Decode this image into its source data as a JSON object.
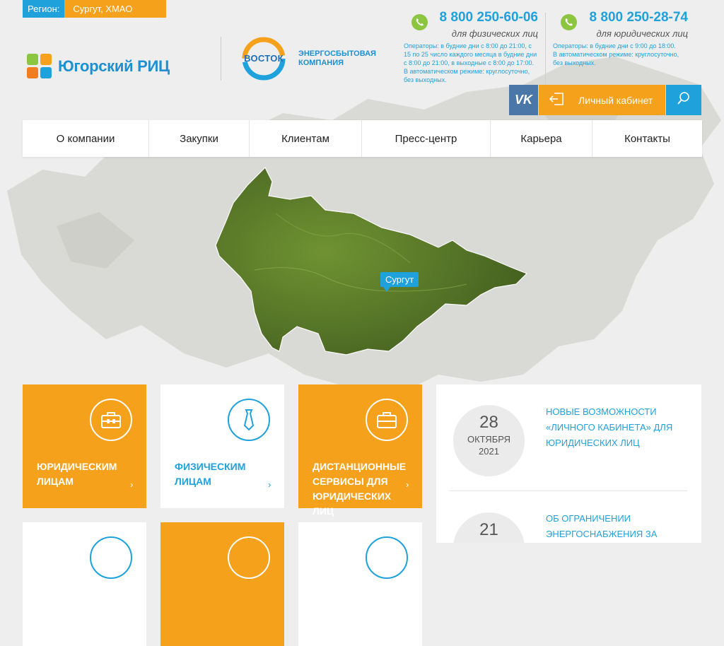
{
  "region": {
    "label": "Регион:",
    "value": "Сургут, ХМАО"
  },
  "logos": {
    "ugra": "Югорский РИЦ",
    "vostok": "ВОСТОК",
    "vostok_sub": "Энергосбытовая компания"
  },
  "phones": [
    {
      "number": "8 800 250-60-06",
      "sub": "для физических лиц",
      "note": "Операторы: в будние дни с 8:00 до 21:00, с 15 по 25 число каждого месяца в будние дни с 8:00 до 21:00, в выходные с 8:00 до 17:00. В автоматическом режиме: круглосуточно, без выходных."
    },
    {
      "number": "8 800 250-28-74",
      "sub": "для юридических лиц",
      "note": "Операторы: в будние дни с 9:00 до 18:00. В автоматическом режиме: круглосуточно, без выходных."
    }
  ],
  "actions": {
    "vk": "vk",
    "cabinet": "Личный кабинет"
  },
  "nav": [
    "О компании",
    "Закупки",
    "Клиентам",
    "Пресс-центр",
    "Карьера",
    "Контакты"
  ],
  "map": {
    "city": "Сургут"
  },
  "tiles": [
    {
      "label": "Юридическим лицам",
      "color": "orange",
      "icon": "briefcase-icon"
    },
    {
      "label": "Физическим лицам",
      "color": "white",
      "icon": "tie-icon"
    },
    {
      "label": "Дистанционные сервисы для юридических лиц",
      "color": "orange",
      "icon": "briefcase-icon"
    },
    {
      "label": "",
      "color": "white",
      "icon": ""
    },
    {
      "label": "",
      "color": "orange",
      "icon": ""
    },
    {
      "label": "",
      "color": "white",
      "icon": ""
    }
  ],
  "tile_arrow": "›",
  "news": [
    {
      "day": "28",
      "month": "октября",
      "year": "2021",
      "title": "Новые возможности «Личного кабинета» для юридических лиц"
    },
    {
      "day": "21",
      "month": "",
      "year": "",
      "title": "Об ограничении энергоснабжения за долги можно узнать через"
    }
  ],
  "colors": {
    "blue": "#1fa2dc",
    "orange": "#f5a11b",
    "green": "#8cc540",
    "vk": "#4a76a8"
  }
}
